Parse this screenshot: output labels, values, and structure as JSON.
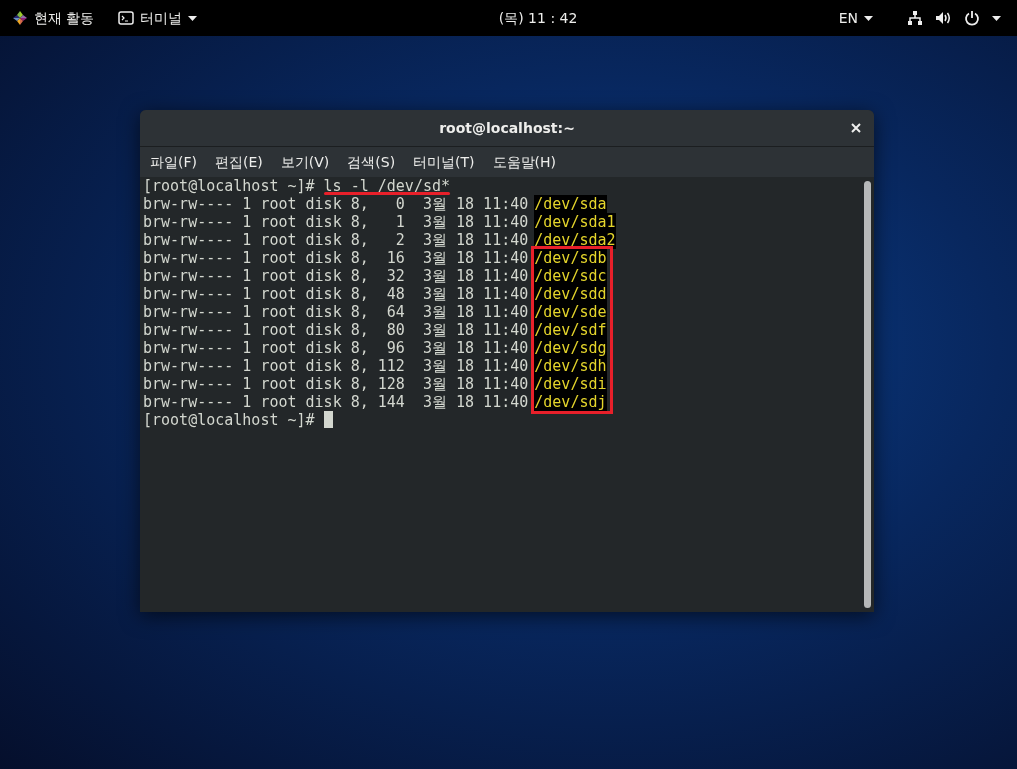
{
  "top_bar": {
    "activities": "현재 활동",
    "app_menu": "터미널",
    "clock": "(목) 11 : 42",
    "language": "EN"
  },
  "window": {
    "title": "root@localhost:~"
  },
  "menu": [
    "파일(F)",
    "편집(E)",
    "보기(V)",
    "검색(S)",
    "터미널(T)",
    "도움말(H)"
  ],
  "terminal": {
    "prompt": "[root@localhost ~]#",
    "command": "ls -l /dev/sd*",
    "command_underlined": true,
    "rows": [
      {
        "listing": "brw-rw---- 1 root disk 8,   0  3월 18 11:40",
        "device": "/dev/sda",
        "highlighted": false
      },
      {
        "listing": "brw-rw---- 1 root disk 8,   1  3월 18 11:40",
        "device": "/dev/sda1",
        "highlighted": false
      },
      {
        "listing": "brw-rw---- 1 root disk 8,   2  3월 18 11:40",
        "device": "/dev/sda2",
        "highlighted": false
      },
      {
        "listing": "brw-rw---- 1 root disk 8,  16  3월 18 11:40",
        "device": "/dev/sdb",
        "highlighted": true
      },
      {
        "listing": "brw-rw---- 1 root disk 8,  32  3월 18 11:40",
        "device": "/dev/sdc",
        "highlighted": true
      },
      {
        "listing": "brw-rw---- 1 root disk 8,  48  3월 18 11:40",
        "device": "/dev/sdd",
        "highlighted": true
      },
      {
        "listing": "brw-rw---- 1 root disk 8,  64  3월 18 11:40",
        "device": "/dev/sde",
        "highlighted": true
      },
      {
        "listing": "brw-rw---- 1 root disk 8,  80  3월 18 11:40",
        "device": "/dev/sdf",
        "highlighted": true
      },
      {
        "listing": "brw-rw---- 1 root disk 8,  96  3월 18 11:40",
        "device": "/dev/sdg",
        "highlighted": true
      },
      {
        "listing": "brw-rw---- 1 root disk 8, 112  3월 18 11:40",
        "device": "/dev/sdh",
        "highlighted": true
      },
      {
        "listing": "brw-rw---- 1 root disk 8, 128  3월 18 11:40",
        "device": "/dev/sdi",
        "highlighted": true
      },
      {
        "listing": "brw-rw---- 1 root disk 8, 144  3월 18 11:40",
        "device": "/dev/sdj",
        "highlighted": true
      }
    ],
    "final_prompt": "[root@localhost ~]#"
  }
}
